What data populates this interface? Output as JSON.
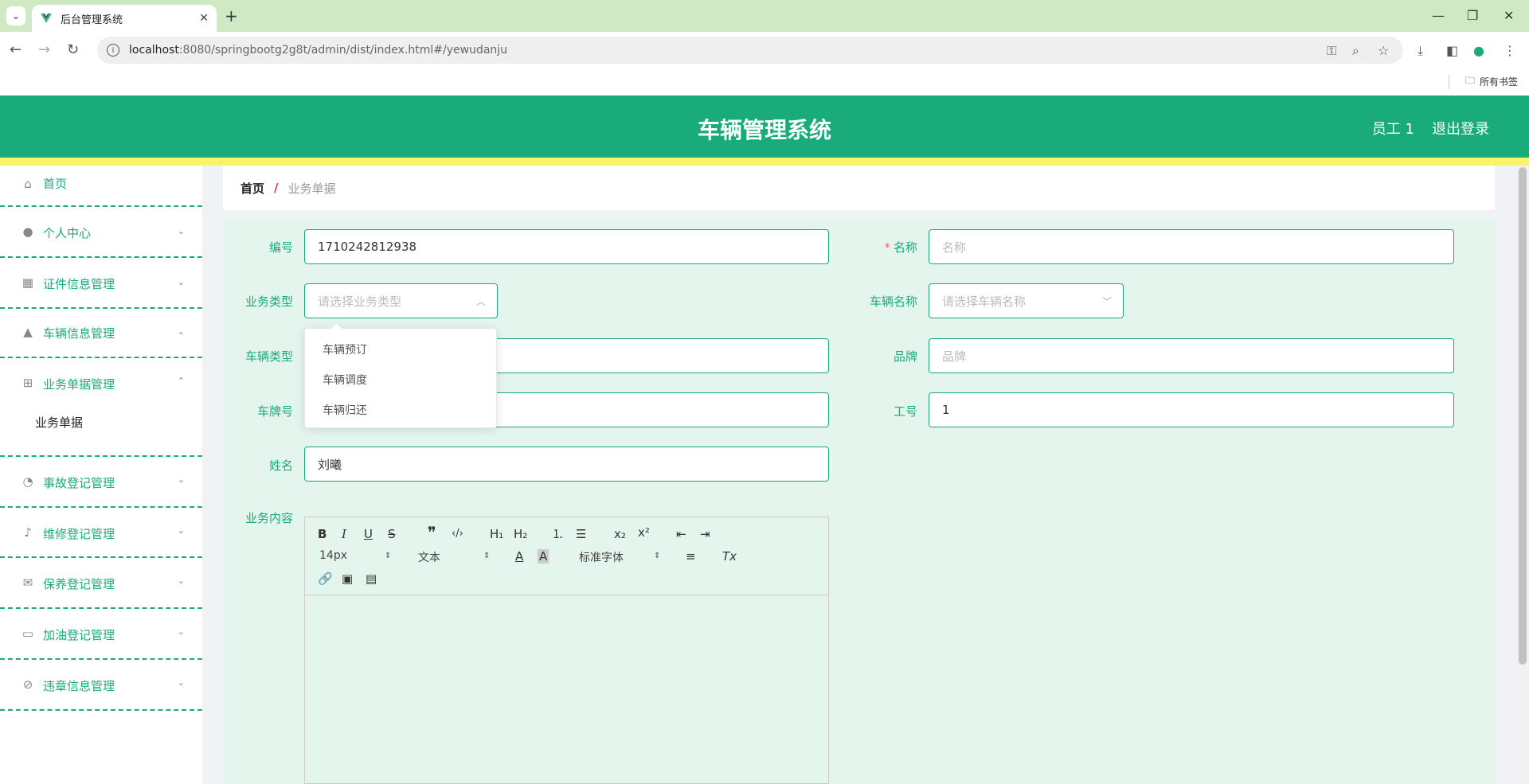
{
  "browser": {
    "tab_title": "后台管理系统",
    "url_host": "localhost",
    "url_rest": ":8080/springbootg2g8t/admin/dist/index.html#/yewudanju",
    "bookmarks_label": "所有书签"
  },
  "header": {
    "title": "车辆管理系统",
    "user": "员工 1",
    "logout": "退出登录"
  },
  "sidebar": {
    "items": [
      {
        "label": "首页"
      },
      {
        "label": "个人中心"
      },
      {
        "label": "证件信息管理"
      },
      {
        "label": "车辆信息管理"
      },
      {
        "label": "业务单据管理"
      },
      {
        "label": "事故登记管理"
      },
      {
        "label": "维修登记管理"
      },
      {
        "label": "保养登记管理"
      },
      {
        "label": "加油登记管理"
      },
      {
        "label": "违章信息管理"
      }
    ],
    "submenu_label": "业务单据"
  },
  "breadcrumb": {
    "home": "首页",
    "separator": "/",
    "current": "业务单据"
  },
  "form": {
    "bianhao_label": "编号",
    "bianhao_value": "1710242812938",
    "mingcheng_label": "名称",
    "mingcheng_placeholder": "名称",
    "yewuleixing_label": "业务类型",
    "yewuleixing_placeholder": "请选择业务类型",
    "cheliangmingcheng_label": "车辆名称",
    "cheliangmingcheng_placeholder": "请选择车辆名称",
    "cheliangleixing_label": "车辆类型",
    "pinpai_label": "品牌",
    "pinpai_placeholder": "品牌",
    "chepaihao_label": "车牌号",
    "gonghao_label": "工号",
    "gonghao_value": "1",
    "xingming_label": "姓名",
    "xingming_value": "刘曦",
    "neirong_label": "业务内容",
    "required_mark": "*"
  },
  "dropdown": {
    "options": [
      "车辆预订",
      "车辆调度",
      "车辆归还"
    ]
  },
  "editor": {
    "font_size": "14px",
    "header": "文本",
    "font": "标准字体",
    "sub": "x₂",
    "sup": "x²",
    "h1": "H₁",
    "h2": "H₂"
  }
}
